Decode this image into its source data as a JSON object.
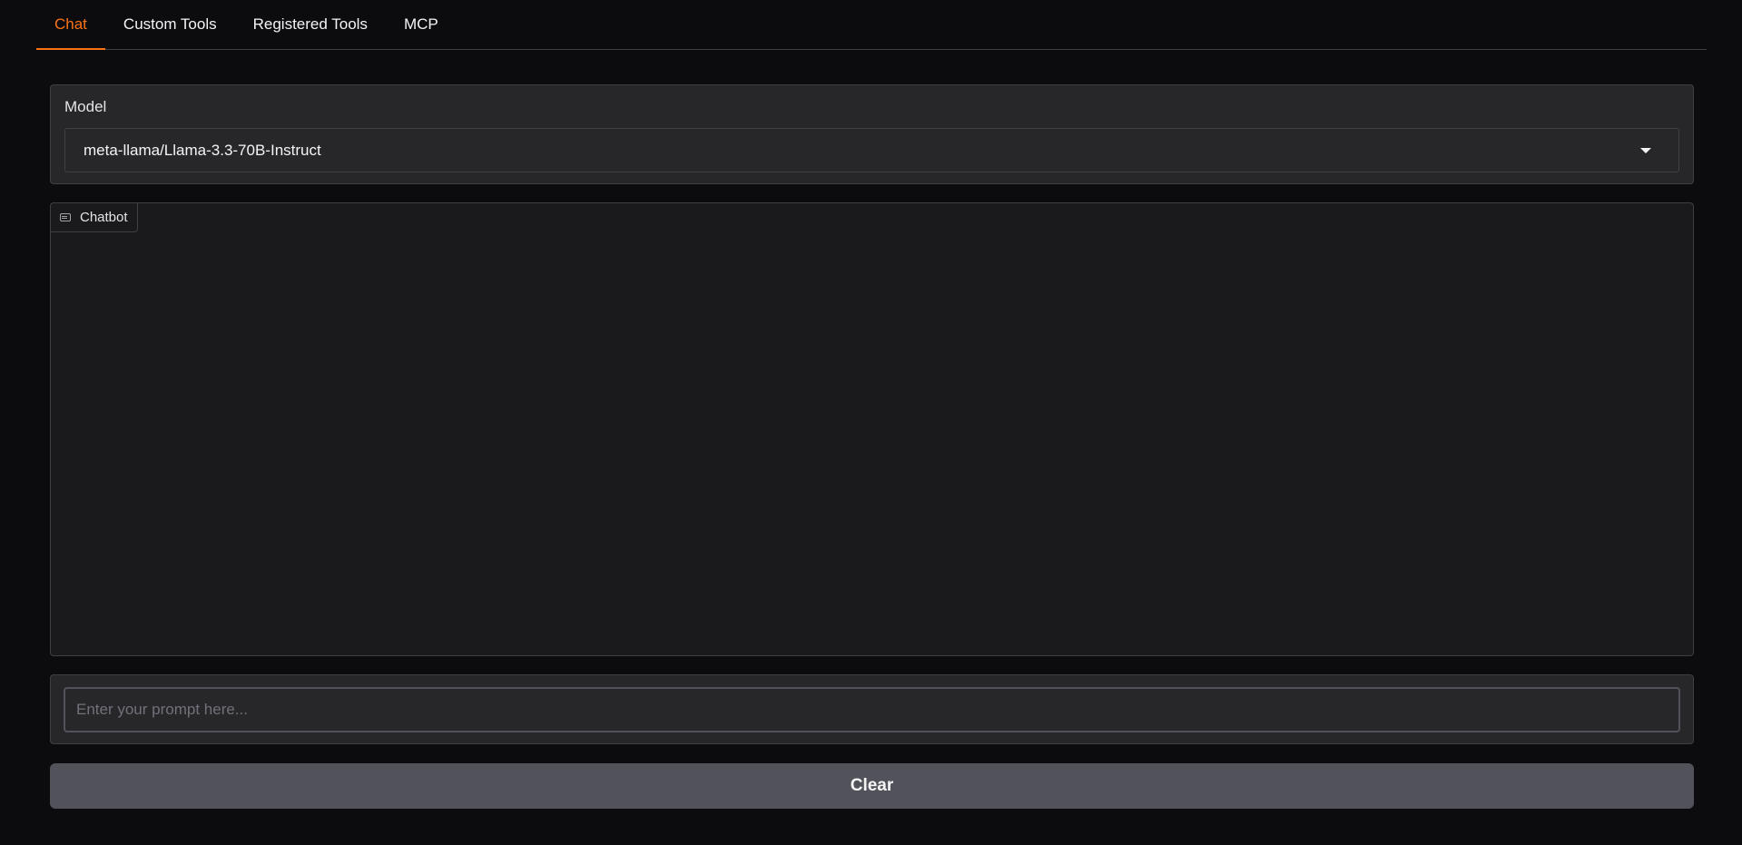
{
  "tabs": [
    {
      "label": "Chat",
      "active": true
    },
    {
      "label": "Custom Tools",
      "active": false
    },
    {
      "label": "Registered Tools",
      "active": false
    },
    {
      "label": "MCP",
      "active": false
    }
  ],
  "model": {
    "label": "Model",
    "selected": "meta-llama/Llama-3.3-70B-Instruct",
    "icon": "chevron-down-icon"
  },
  "chatbot": {
    "label": "Chatbot",
    "icon": "chat-icon"
  },
  "prompt": {
    "placeholder": "Enter your prompt here...",
    "value": ""
  },
  "clear_button": {
    "label": "Clear"
  },
  "colors": {
    "accent": "#f97316",
    "background": "#0c0c0f",
    "panel": "#27272a",
    "button": "#52525b"
  }
}
